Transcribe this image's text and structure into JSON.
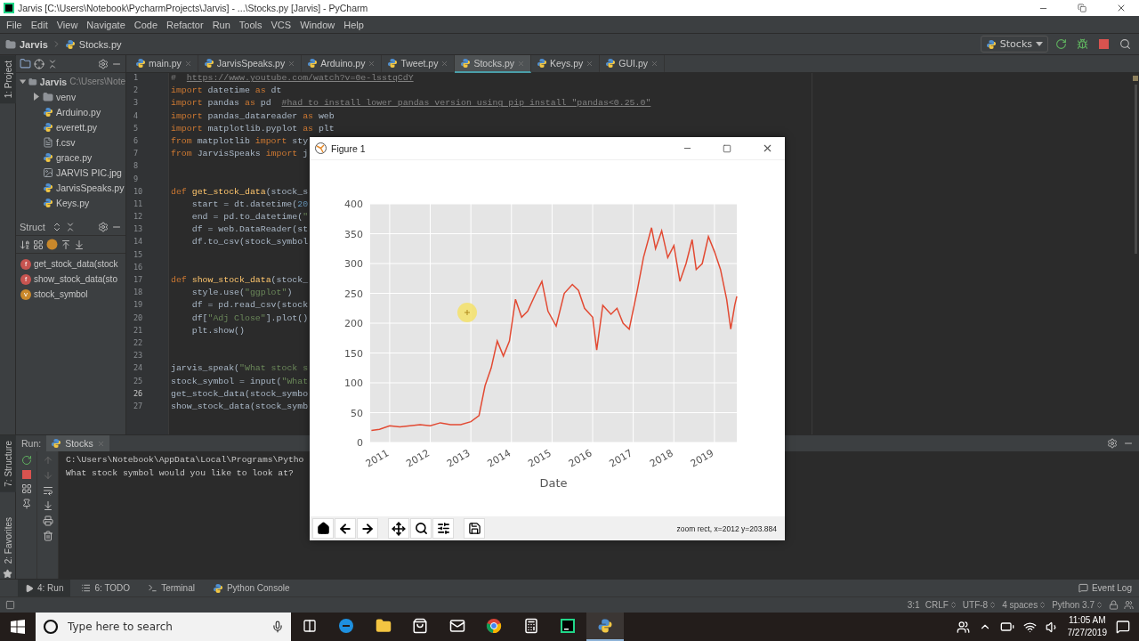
{
  "window": {
    "title": "Jarvis [C:\\Users\\Notebook\\PycharmProjects\\Jarvis] - ...\\Stocks.py [Jarvis] - PyCharm"
  },
  "menu": [
    "File",
    "Edit",
    "View",
    "Navigate",
    "Code",
    "Refactor",
    "Run",
    "Tools",
    "VCS",
    "Window",
    "Help"
  ],
  "breadcrumb": [
    {
      "label": "Jarvis",
      "kind": "folder"
    },
    {
      "label": "Stocks.py",
      "kind": "py"
    }
  ],
  "run_config": {
    "label": "Stocks"
  },
  "side_tabs": {
    "top": "1: Project",
    "middle": "7: Structure",
    "bottom": "2: Favorites"
  },
  "project_tree": [
    {
      "label": "Jarvis",
      "hint": "C:\\Users\\Note",
      "kind": "folder",
      "expanded": true,
      "children": [
        {
          "label": "venv",
          "kind": "folder",
          "expanded": false
        },
        {
          "label": "Arduino.py",
          "kind": "py"
        },
        {
          "label": "everett.py",
          "kind": "py"
        },
        {
          "label": "f.csv",
          "kind": "text"
        },
        {
          "label": "grace.py",
          "kind": "py"
        },
        {
          "label": "JARVIS PIC.jpg",
          "kind": "image"
        },
        {
          "label": "JarvisSpeaks.py",
          "kind": "py"
        },
        {
          "label": "Keys.py",
          "kind": "py"
        }
      ]
    }
  ],
  "structure": {
    "title": "Struct",
    "items": [
      {
        "badge": "f",
        "label": "get_stock_data(stock",
        "kind": "function"
      },
      {
        "badge": "f",
        "label": "show_stock_data(sto",
        "kind": "function"
      },
      {
        "badge": "v",
        "label": "stock_symbol",
        "kind": "variable"
      }
    ]
  },
  "editor_tabs": [
    {
      "label": "main.py",
      "selected": false
    },
    {
      "label": "JarvisSpeaks.py",
      "selected": false
    },
    {
      "label": "Arduino.py",
      "selected": false
    },
    {
      "label": "Tweet.py",
      "selected": false
    },
    {
      "label": "Stocks.py",
      "selected": true
    },
    {
      "label": "Keys.py",
      "selected": false
    },
    {
      "label": "GUI.py",
      "selected": false
    }
  ],
  "code": [
    {
      "number": "1",
      "current": false,
      "parts": [
        {
          "kind": "comment",
          "text": "#  "
        },
        {
          "kind": "link",
          "text": "https://www.youtube.com/watch?v=0e-lsstqCdY"
        }
      ]
    },
    {
      "number": "2",
      "current": false,
      "parts": [
        {
          "kind": "keyword",
          "text": "import"
        },
        {
          "kind": "plain",
          "text": " datetime "
        },
        {
          "kind": "keyword",
          "text": "as"
        },
        {
          "kind": "plain",
          "text": " dt"
        }
      ]
    },
    {
      "number": "3",
      "current": false,
      "parts": [
        {
          "kind": "keyword",
          "text": "import"
        },
        {
          "kind": "plain",
          "text": " pandas "
        },
        {
          "kind": "keyword",
          "text": "as"
        },
        {
          "kind": "plain",
          "text": " pd  "
        },
        {
          "kind": "link",
          "text": "#had to install lower pandas version using pip install \"pandas<0.25.0\""
        }
      ]
    },
    {
      "number": "4",
      "current": false,
      "parts": [
        {
          "kind": "keyword",
          "text": "import"
        },
        {
          "kind": "plain",
          "text": " pandas_datareader "
        },
        {
          "kind": "keyword",
          "text": "as"
        },
        {
          "kind": "plain",
          "text": " web"
        }
      ]
    },
    {
      "number": "5",
      "current": false,
      "parts": [
        {
          "kind": "keyword",
          "text": "import"
        },
        {
          "kind": "plain",
          "text": " matplotlib.pyplot "
        },
        {
          "kind": "keyword",
          "text": "as"
        },
        {
          "kind": "plain",
          "text": " plt"
        }
      ]
    },
    {
      "number": "6",
      "current": false,
      "parts": [
        {
          "kind": "keyword",
          "text": "from"
        },
        {
          "kind": "plain",
          "text": " matplotlib "
        },
        {
          "kind": "keyword",
          "text": "import"
        },
        {
          "kind": "plain",
          "text": " sty"
        }
      ]
    },
    {
      "number": "7",
      "current": false,
      "parts": [
        {
          "kind": "keyword",
          "text": "from"
        },
        {
          "kind": "plain",
          "text": " JarvisSpeaks "
        },
        {
          "kind": "keyword",
          "text": "import"
        },
        {
          "kind": "plain",
          "text": " j"
        }
      ]
    },
    {
      "number": "8",
      "current": false
    },
    {
      "number": "9",
      "current": false
    },
    {
      "number": "10",
      "current": false,
      "parts": [
        {
          "kind": "keyword",
          "text": "def"
        },
        {
          "kind": "function",
          "text": " get_stock_data"
        },
        {
          "kind": "plain",
          "text": "(stock_s"
        }
      ]
    },
    {
      "number": "11",
      "current": false,
      "parts": [
        {
          "kind": "plain",
          "text": "    start = dt.datetime("
        },
        {
          "kind": "number",
          "text": "20"
        }
      ]
    },
    {
      "number": "12",
      "current": false,
      "parts": [
        {
          "kind": "plain",
          "text": "    end = pd.to_datetime("
        },
        {
          "kind": "string",
          "text": "\""
        }
      ]
    },
    {
      "number": "13",
      "current": false,
      "parts": [
        {
          "kind": "plain",
          "text": "    df = web.DataReader(st"
        }
      ]
    },
    {
      "number": "14",
      "current": false,
      "parts": [
        {
          "kind": "plain",
          "text": "    df.to_csv(stock_symbol"
        }
      ]
    },
    {
      "number": "15",
      "current": false
    },
    {
      "number": "16",
      "current": false
    },
    {
      "number": "17",
      "current": false,
      "parts": [
        {
          "kind": "keyword",
          "text": "def"
        },
        {
          "kind": "function",
          "text": " show_stock_data"
        },
        {
          "kind": "plain",
          "text": "(stock_"
        }
      ]
    },
    {
      "number": "18",
      "current": false,
      "parts": [
        {
          "kind": "plain",
          "text": "    style.use("
        },
        {
          "kind": "string",
          "text": "\"ggplot\""
        },
        {
          "kind": "plain",
          "text": ")"
        }
      ]
    },
    {
      "number": "19",
      "current": false,
      "parts": [
        {
          "kind": "plain",
          "text": "    df = pd.read_csv(stock"
        }
      ]
    },
    {
      "number": "20",
      "current": false,
      "parts": [
        {
          "kind": "plain",
          "text": "    df["
        },
        {
          "kind": "string",
          "text": "\"Adj Close\""
        },
        {
          "kind": "plain",
          "text": "].plot()"
        }
      ]
    },
    {
      "number": "21",
      "current": false,
      "parts": [
        {
          "kind": "plain",
          "text": "    plt.show()"
        }
      ]
    },
    {
      "number": "22",
      "current": false
    },
    {
      "number": "23",
      "current": false
    },
    {
      "number": "24",
      "current": false,
      "parts": [
        {
          "kind": "plain",
          "text": "jarvis_speak("
        },
        {
          "kind": "string",
          "text": "\"What stock s"
        }
      ]
    },
    {
      "number": "25",
      "current": false,
      "parts": [
        {
          "kind": "plain",
          "text": "stock_symbol = input("
        },
        {
          "kind": "string",
          "text": "\"What"
        }
      ]
    },
    {
      "number": "26",
      "current": true,
      "parts": [
        {
          "kind": "plain",
          "text": "get_stock_data(stock_symbo"
        }
      ]
    },
    {
      "number": "27",
      "current": false,
      "parts": [
        {
          "kind": "plain",
          "text": "show_stock_data(stock_symb"
        }
      ]
    }
  ],
  "run_panel": {
    "title": "Run:",
    "tab": "Stocks",
    "output": [
      "C:\\Users\\Notebook\\AppData\\Local\\Programs\\Pytho",
      "What stock symbol would you like to look at?"
    ]
  },
  "tool_tabs": [
    {
      "label": "4: Run",
      "kind": "run",
      "selected": true
    },
    {
      "label": "6: TODO",
      "kind": "todo",
      "selected": false
    },
    {
      "label": "Terminal",
      "kind": "terminal",
      "selected": false
    },
    {
      "label": "Python Console",
      "kind": "console",
      "selected": false
    }
  ],
  "event_log": "Event Log",
  "status_bar": {
    "position": "3:1",
    "items": [
      "CRLF",
      "UTF-8",
      "4 spaces",
      "Python 3.7"
    ]
  },
  "figure": {
    "title": "Figure 1",
    "status": "zoom rect, x=2012 y=203.884",
    "chart_data": {
      "type": "line",
      "xlabel": "Date",
      "grid": true,
      "xlim": [
        2010.52,
        2019.55
      ],
      "ylim": [
        0,
        400
      ],
      "xticks": [
        {
          "value": 2011,
          "label": "2011"
        },
        {
          "value": 2012,
          "label": "2012"
        },
        {
          "value": 2013,
          "label": "2013"
        },
        {
          "value": 2014,
          "label": "2014"
        },
        {
          "value": 2015,
          "label": "2015"
        },
        {
          "value": 2016,
          "label": "2016"
        },
        {
          "value": 2017,
          "label": "2017"
        },
        {
          "value": 2018,
          "label": "2018"
        },
        {
          "value": 2019,
          "label": "2019"
        }
      ],
      "yticks": [
        0,
        50,
        100,
        150,
        200,
        250,
        300,
        350,
        400
      ],
      "x": [
        2010.55,
        2010.75,
        2011.0,
        2011.25,
        2011.5,
        2011.75,
        2012.0,
        2012.25,
        2012.5,
        2012.75,
        2013.0,
        2013.2,
        2013.35,
        2013.5,
        2013.65,
        2013.8,
        2013.95,
        2014.1,
        2014.25,
        2014.4,
        2014.6,
        2014.75,
        2014.9,
        2015.1,
        2015.3,
        2015.5,
        2015.65,
        2015.8,
        2016.0,
        2016.1,
        2016.25,
        2016.45,
        2016.6,
        2016.75,
        2016.9,
        2017.1,
        2017.25,
        2017.45,
        2017.55,
        2017.7,
        2017.85,
        2018.0,
        2018.15,
        2018.3,
        2018.45,
        2018.55,
        2018.7,
        2018.85,
        2019.0,
        2019.15,
        2019.3,
        2019.4,
        2019.5,
        2019.55
      ],
      "series": [
        {
          "color": "#e24a33",
          "values": [
            20,
            22,
            28,
            26,
            28,
            30,
            28,
            33,
            30,
            30,
            35,
            45,
            95,
            125,
            170,
            145,
            170,
            240,
            210,
            220,
            250,
            270,
            220,
            195,
            250,
            265,
            255,
            225,
            210,
            155,
            230,
            215,
            225,
            200,
            190,
            255,
            310,
            360,
            325,
            355,
            310,
            330,
            270,
            300,
            340,
            290,
            300,
            345,
            320,
            290,
            240,
            190,
            230,
            245
          ]
        }
      ]
    }
  },
  "taskbar": {
    "search": {
      "placeholder": "Type here to search"
    },
    "apps": [
      {
        "kind": "taskview",
        "selected": false
      },
      {
        "kind": "edge",
        "selected": false
      },
      {
        "kind": "explorer",
        "selected": false
      },
      {
        "kind": "store",
        "selected": false
      },
      {
        "kind": "mail",
        "selected": false
      },
      {
        "kind": "chrome",
        "selected": false
      },
      {
        "kind": "calculator",
        "selected": false
      },
      {
        "kind": "pycharm",
        "selected": false
      },
      {
        "kind": "python",
        "selected": true
      }
    ],
    "time": "11:05 AM",
    "date": "7/27/2019"
  }
}
